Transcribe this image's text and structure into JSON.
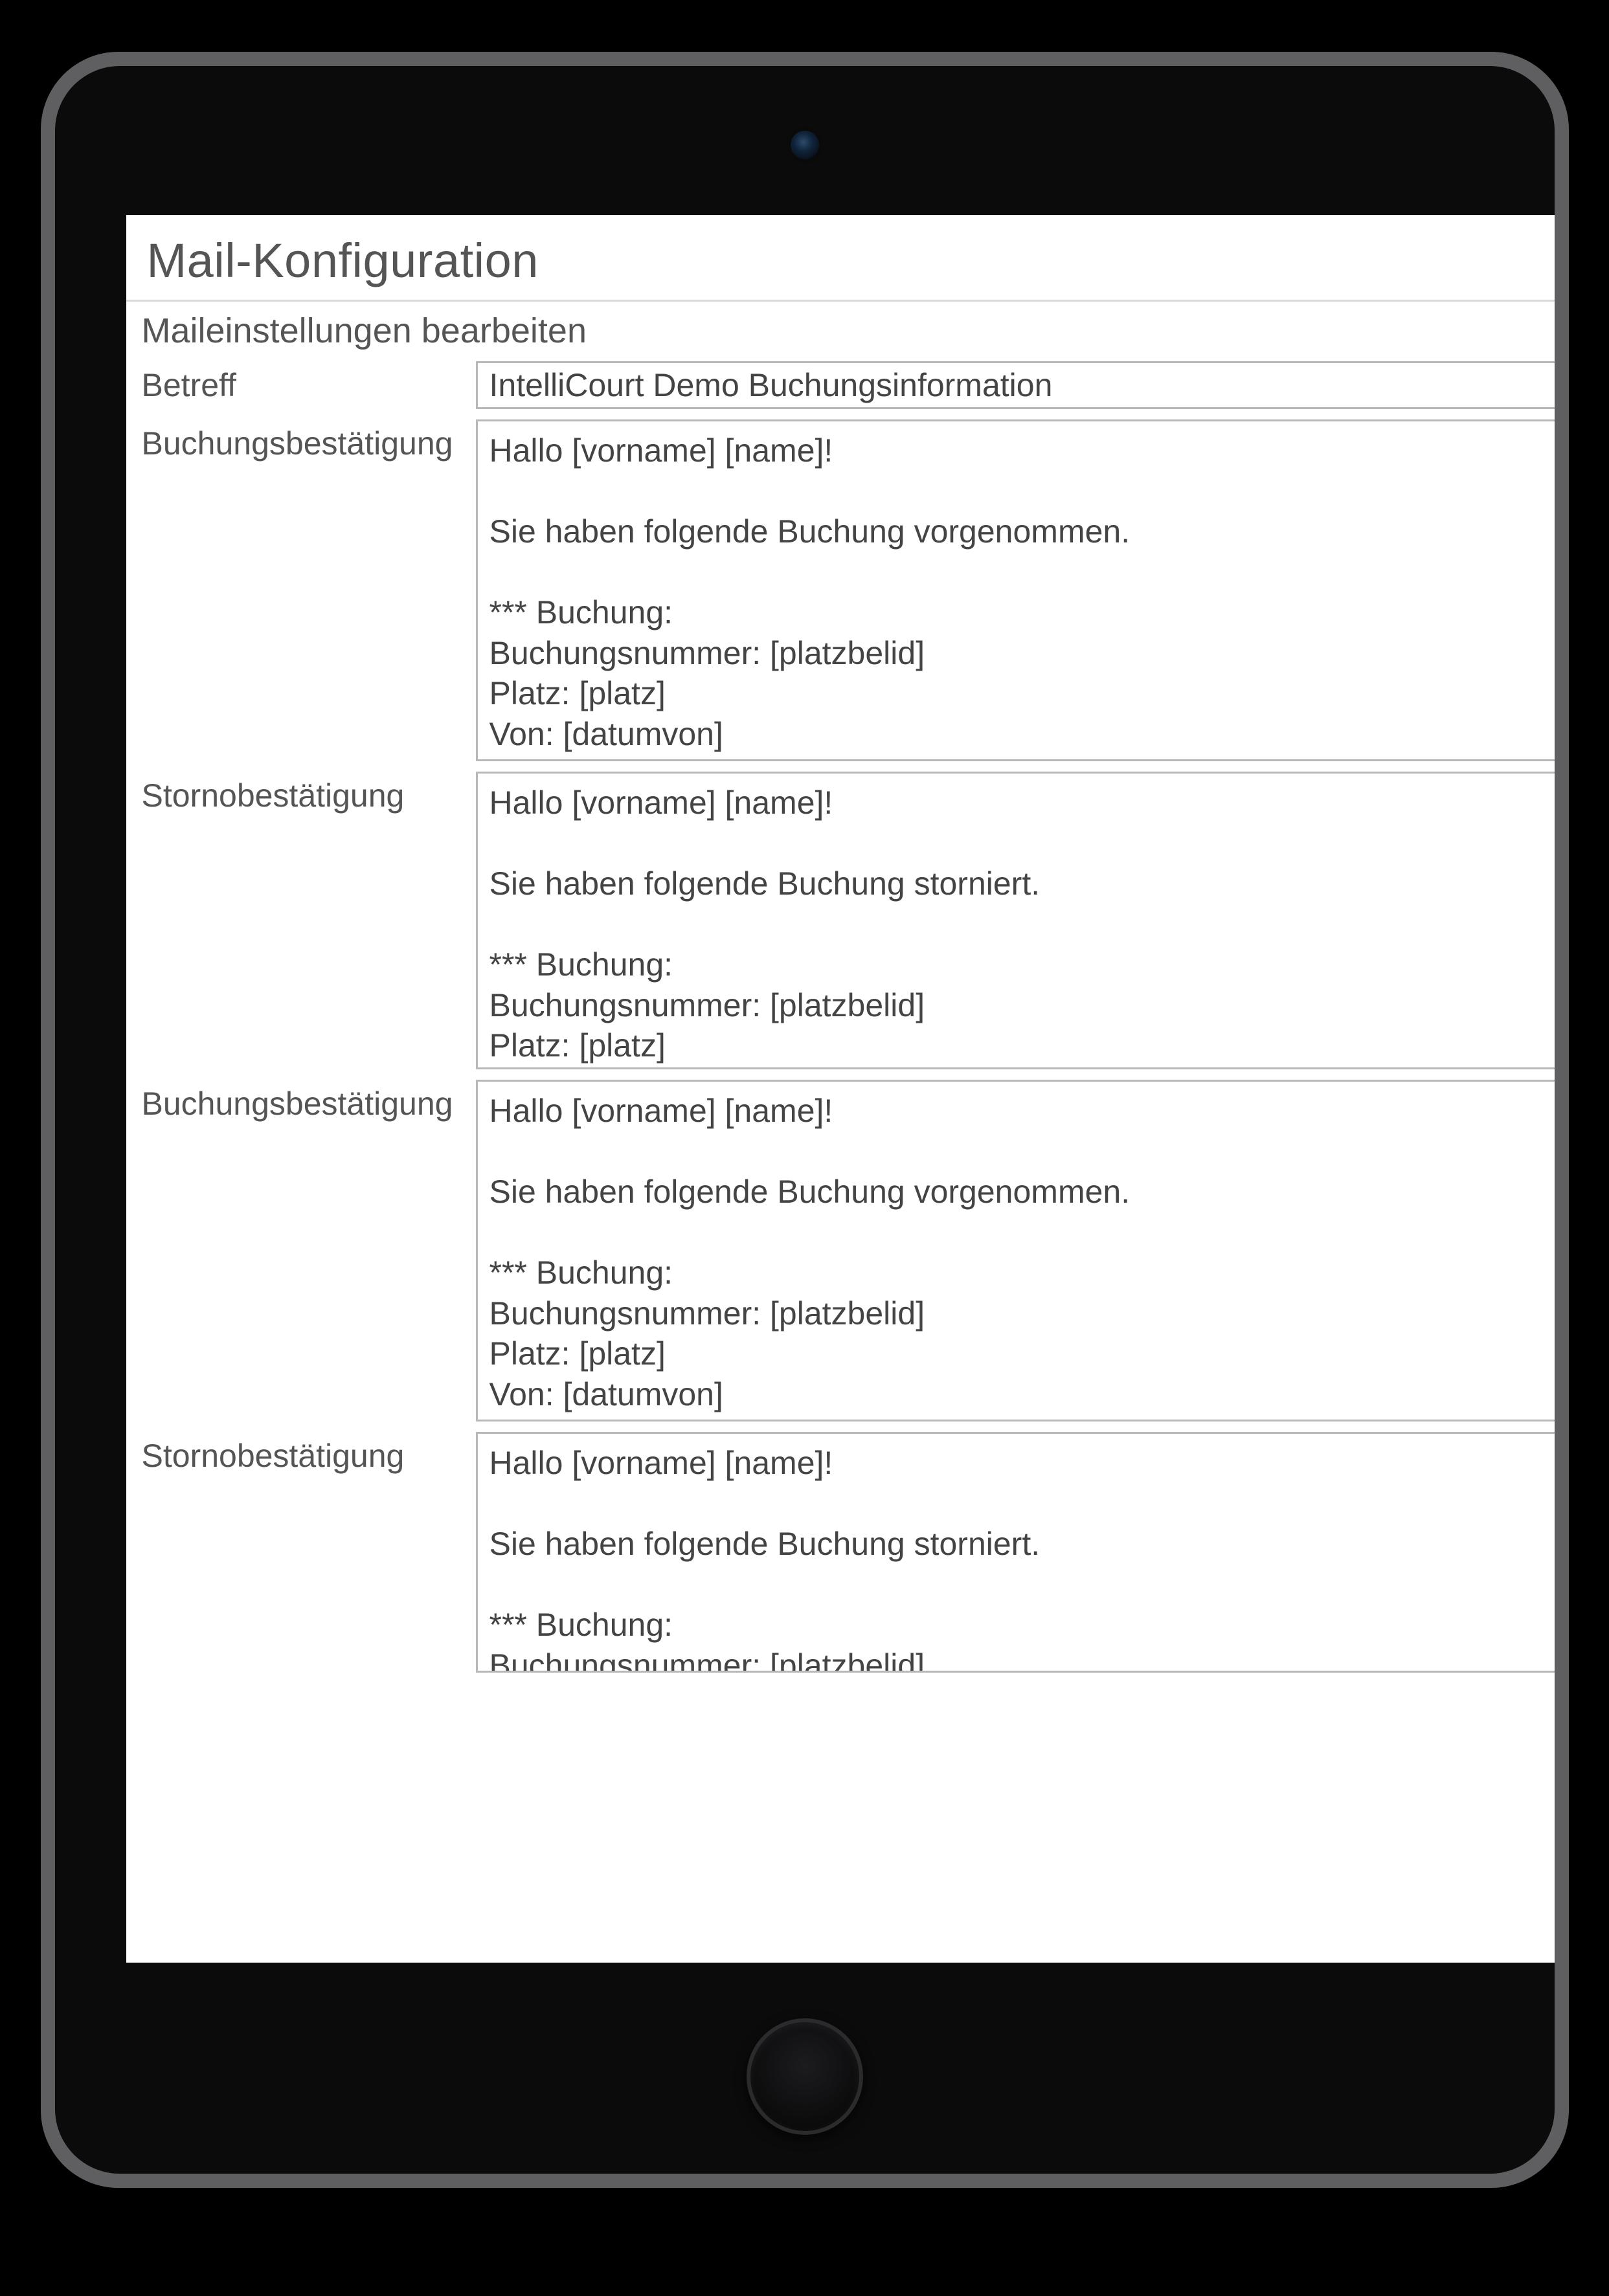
{
  "page": {
    "title": "Mail-Konfiguration",
    "subtitle": "Maileinstellungen bearbeiten"
  },
  "fields": {
    "betreff": {
      "label": "Betreff",
      "value": "IntelliCourt Demo Buchungsinformation"
    },
    "buchung1": {
      "label": "Buchungsbestätigung",
      "value": "Hallo [vorname] [name]!\n\nSie haben folgende Buchung vorgenommen.\n\n*** Buchung:\nBuchungsnummer: [platzbelid]\nPlatz: [platz]\nVon: [datumvon]\nBis: [datumbis]"
    },
    "storno1": {
      "label": "Stornobestätigung",
      "value": "Hallo [vorname] [name]!\n\nSie haben folgende Buchung storniert.\n\n*** Buchung:\nBuchungsnummer: [platzbelid]\nPlatz: [platz]\nVon: [datumvon]"
    },
    "buchung2": {
      "label": "Buchungsbestätigung",
      "value": "Hallo [vorname] [name]!\n\nSie haben folgende Buchung vorgenommen.\n\n*** Buchung:\nBuchungsnummer: [platzbelid]\nPlatz: [platz]\nVon: [datumvon]\nBis: [datumbis]"
    },
    "storno2": {
      "label": "Stornobestätigung",
      "value": "Hallo [vorname] [name]!\n\nSie haben folgende Buchung storniert.\n\n*** Buchung:\nBuchungsnummer: [platzbelid]"
    }
  }
}
